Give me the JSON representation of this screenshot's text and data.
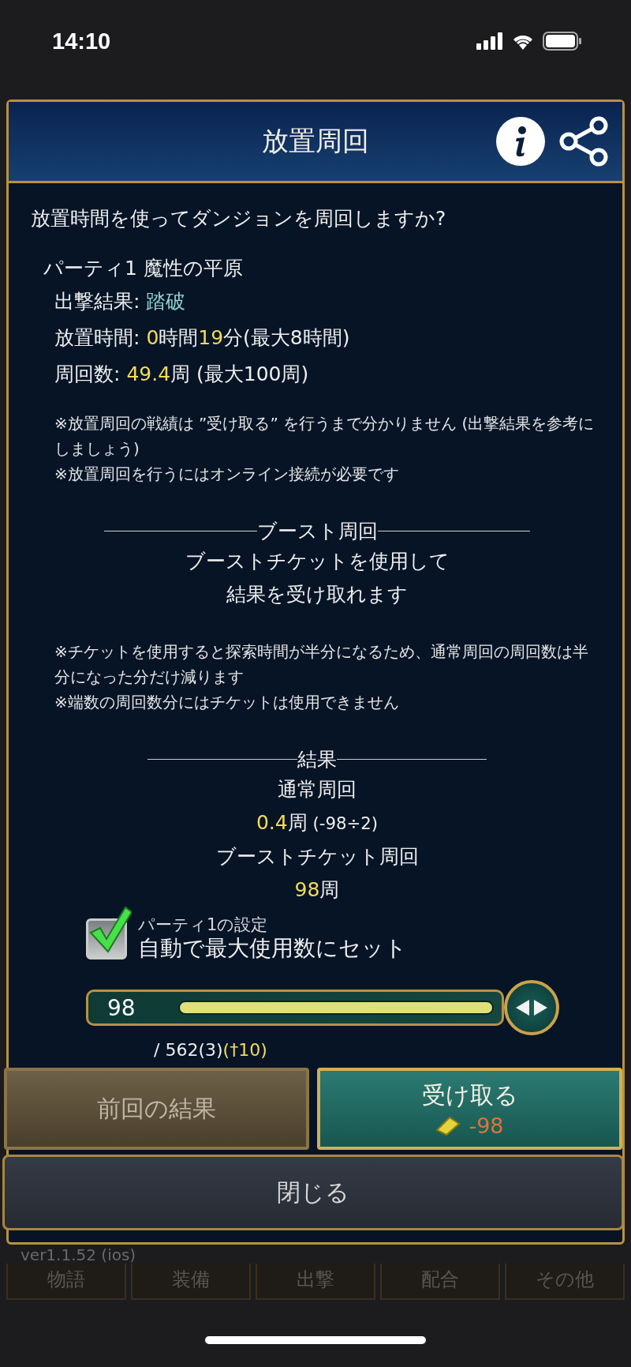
{
  "status_bar": {
    "time": "14:10"
  },
  "dialog": {
    "title": "放置周回",
    "question": "放置時間を使ってダンジョンを周回しますか?",
    "party": "パーティ1 魔性の平原",
    "stats": [
      {
        "parts": [
          {
            "text": "出撃結果: ",
            "kind": "plain"
          },
          {
            "text": "踏破",
            "kind": "result"
          }
        ]
      },
      {
        "parts": [
          {
            "text": "放置時間: ",
            "kind": "plain"
          },
          {
            "text": "0",
            "kind": "highlight"
          },
          {
            "text": "時間",
            "kind": "plain"
          },
          {
            "text": "19",
            "kind": "highlight"
          },
          {
            "text": "分(最大8時間)",
            "kind": "plain"
          }
        ]
      },
      {
        "parts": [
          {
            "text": "周回数: ",
            "kind": "plain"
          },
          {
            "text": "49.4",
            "kind": "highlight"
          },
          {
            "text": "周 (最大100周)",
            "kind": "plain"
          }
        ]
      }
    ],
    "notes": [
      "※放置周回の戦績は ”受け取る” を行うまで分かりません (出撃結果を参考にしましょう)",
      "※放置周回を行うにはオンライン接続が必要です"
    ],
    "boost": {
      "heading": "ブースト周回",
      "description": [
        "ブーストチケットを使用して",
        "結果を受け取れます"
      ],
      "notes": [
        "※チケットを使用すると探索時間が半分になるため、通常周回の周回数は半分になった分だけ減ります",
        "※端数の周回数分にはチケットは使用できません"
      ]
    },
    "result": {
      "heading": "結果",
      "normal_label": "通常周回",
      "normal_value": [
        {
          "text": "0.4",
          "kind": "highlight"
        },
        {
          "text": "周",
          "kind": "plain"
        },
        {
          "text": " (-98÷2)",
          "kind": "small"
        }
      ],
      "boost_label": "ブーストチケット周回",
      "boost_value": [
        {
          "text": "98",
          "kind": "highlight"
        },
        {
          "text": "周",
          "kind": "plain"
        }
      ]
    },
    "auto_set": {
      "checked": true,
      "caption": "パーティ1の設定",
      "label": "自動で最大使用数にセット"
    },
    "slider": {
      "value": "98",
      "level": 1,
      "total": [
        {
          "text": "/ 562(3)",
          "kind": "plain"
        },
        {
          "text": "(†10)",
          "kind": "highlight"
        }
      ]
    },
    "buttons": {
      "previous": "前回の結果",
      "receive": "受け取る",
      "receive_cost": "-98",
      "close": "閉じる"
    }
  },
  "tab_bar": {
    "version": "ver1.1.52 (ios)",
    "tabs": [
      "物語",
      "装備",
      "出撃",
      "配合",
      "その他"
    ]
  }
}
